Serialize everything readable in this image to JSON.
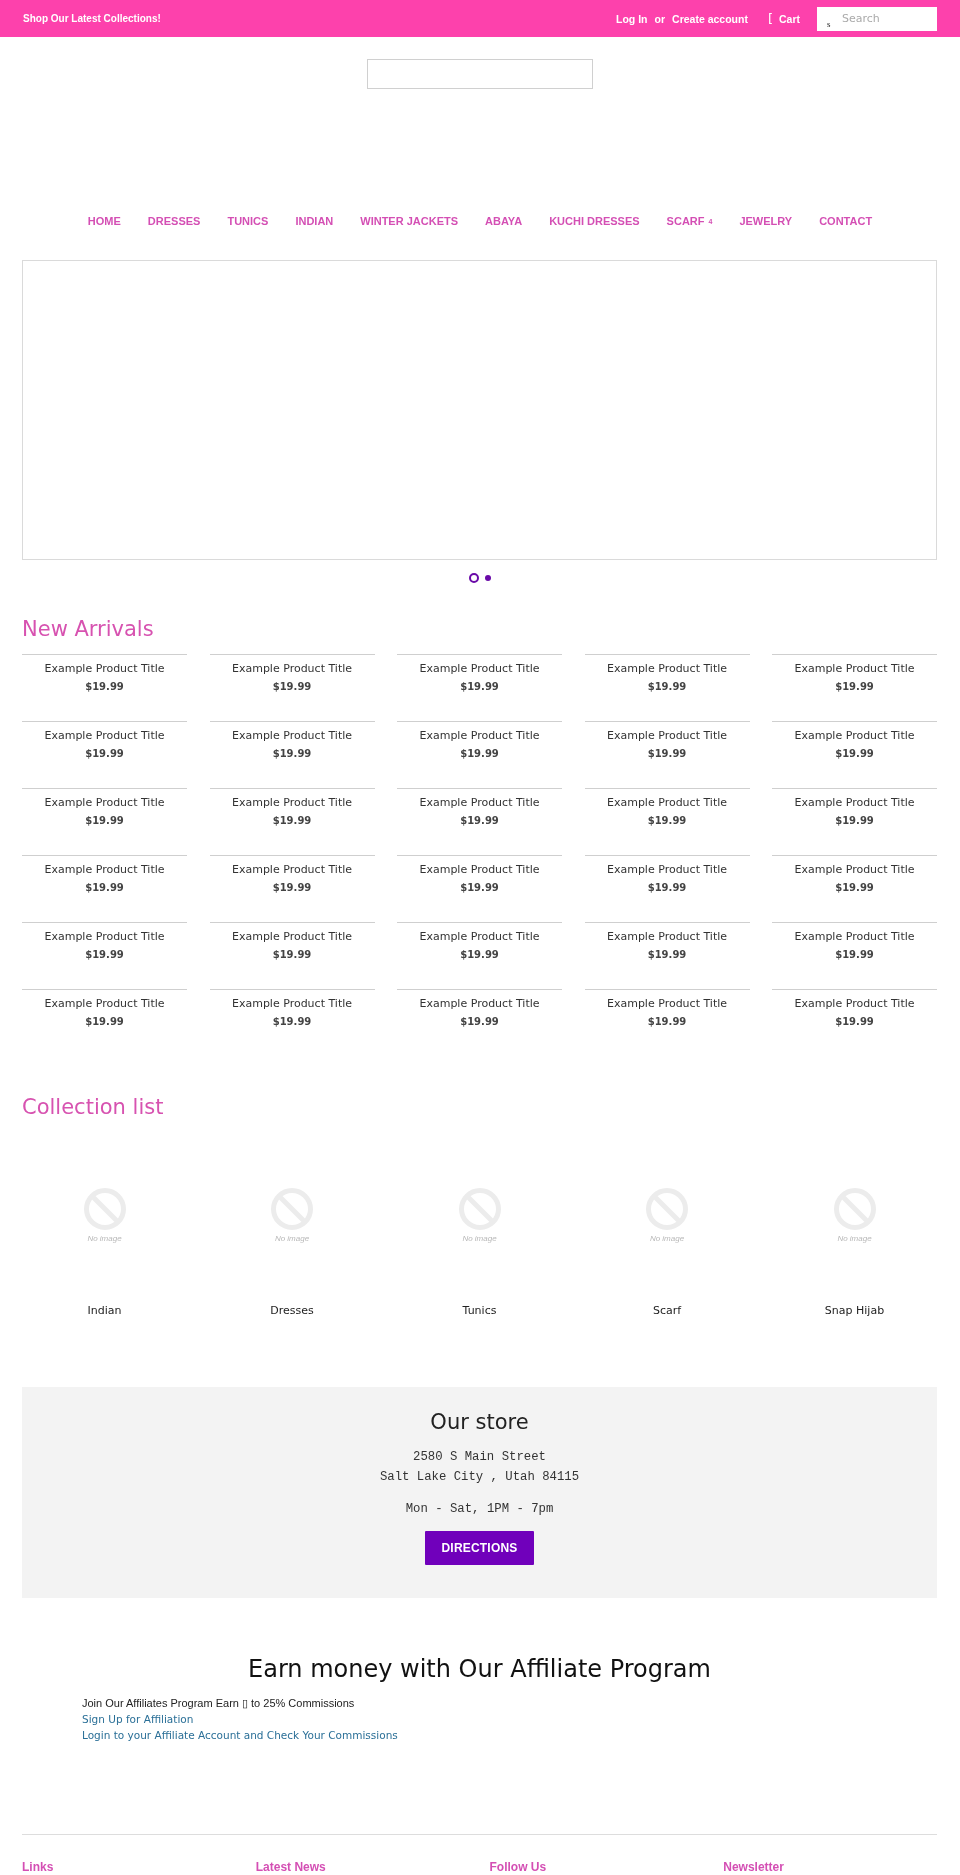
{
  "top_bar": {
    "promo": "Shop Our Latest Collections!",
    "login_link": "Log In",
    "separator": "or",
    "create_account_link": "Create account",
    "cart": {
      "glyph": "[",
      "label": "Cart"
    },
    "search": {
      "glyph": "s",
      "placeholder": "Search"
    }
  },
  "nav": [
    {
      "label": "HOME"
    },
    {
      "label": "DRESSES"
    },
    {
      "label": "TUNICS"
    },
    {
      "label": "INDIAN"
    },
    {
      "label": "WINTER JACKETS"
    },
    {
      "label": "ABAYA"
    },
    {
      "label": "KUCHI DRESSES"
    },
    {
      "label": "SCARF",
      "dropdown_glyph": "4"
    },
    {
      "label": "JEWELRY"
    },
    {
      "label": "CONTACT"
    }
  ],
  "slideshow": {
    "dots": [
      {
        "selected": true
      },
      {
        "selected": false
      }
    ]
  },
  "new_arrivals": {
    "title": "New Arrivals",
    "products": [
      {
        "title": "Example Product Title",
        "price": "$19.99"
      },
      {
        "title": "Example Product Title",
        "price": "$19.99"
      },
      {
        "title": "Example Product Title",
        "price": "$19.99"
      },
      {
        "title": "Example Product Title",
        "price": "$19.99"
      },
      {
        "title": "Example Product Title",
        "price": "$19.99"
      },
      {
        "title": "Example Product Title",
        "price": "$19.99"
      },
      {
        "title": "Example Product Title",
        "price": "$19.99"
      },
      {
        "title": "Example Product Title",
        "price": "$19.99"
      },
      {
        "title": "Example Product Title",
        "price": "$19.99"
      },
      {
        "title": "Example Product Title",
        "price": "$19.99"
      },
      {
        "title": "Example Product Title",
        "price": "$19.99"
      },
      {
        "title": "Example Product Title",
        "price": "$19.99"
      },
      {
        "title": "Example Product Title",
        "price": "$19.99"
      },
      {
        "title": "Example Product Title",
        "price": "$19.99"
      },
      {
        "title": "Example Product Title",
        "price": "$19.99"
      },
      {
        "title": "Example Product Title",
        "price": "$19.99"
      },
      {
        "title": "Example Product Title",
        "price": "$19.99"
      },
      {
        "title": "Example Product Title",
        "price": "$19.99"
      },
      {
        "title": "Example Product Title",
        "price": "$19.99"
      },
      {
        "title": "Example Product Title",
        "price": "$19.99"
      },
      {
        "title": "Example Product Title",
        "price": "$19.99"
      },
      {
        "title": "Example Product Title",
        "price": "$19.99"
      },
      {
        "title": "Example Product Title",
        "price": "$19.99"
      },
      {
        "title": "Example Product Title",
        "price": "$19.99"
      },
      {
        "title": "Example Product Title",
        "price": "$19.99"
      },
      {
        "title": "Example Product Title",
        "price": "$19.99"
      },
      {
        "title": "Example Product Title",
        "price": "$19.99"
      },
      {
        "title": "Example Product Title",
        "price": "$19.99"
      },
      {
        "title": "Example Product Title",
        "price": "$19.99"
      },
      {
        "title": "Example Product Title",
        "price": "$19.99"
      }
    ]
  },
  "collections": {
    "title": "Collection list",
    "items": [
      {
        "name": "Indian",
        "image_label": "No image"
      },
      {
        "name": "Dresses",
        "image_label": "No image"
      },
      {
        "name": "Tunics",
        "image_label": "No image"
      },
      {
        "name": "Scarf",
        "image_label": "No image"
      },
      {
        "name": "Snap Hijab",
        "image_label": "No image"
      }
    ]
  },
  "store": {
    "title": "Our store",
    "address_lines": [
      "2580 S Main Street",
      "Salt Lake City , Utah 84115"
    ],
    "hours": "Mon - Sat, 1PM - 7pm",
    "button": "DIRECTIONS"
  },
  "affiliate": {
    "title": "Earn money with Our Affiliate Program",
    "intro": "Join Our Affiliates Program Earn ▯ to 25% Commissions",
    "links": [
      "Sign Up for Affiliation",
      "Login to your Affiliate Account and Check Your Commissions"
    ]
  },
  "footer": {
    "headings": [
      "Links",
      "Latest News",
      "Follow Us",
      "Newsletter"
    ]
  }
}
